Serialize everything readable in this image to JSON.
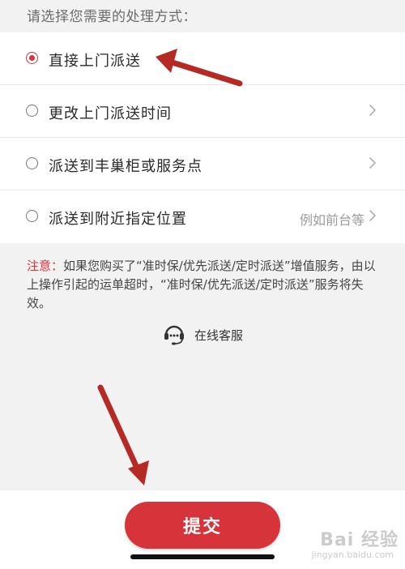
{
  "prompt": "请选择您需要的处理方式：",
  "options": [
    {
      "label": "直接上门派送",
      "selected": true,
      "hint": ""
    },
    {
      "label": "更改上门派送时间",
      "selected": false,
      "hint": ""
    },
    {
      "label": "派送到丰巢柜或服务点",
      "selected": false,
      "hint": ""
    },
    {
      "label": "派送到附近指定位置",
      "selected": false,
      "hint": "例如前台等"
    }
  ],
  "notice": {
    "label": "注意：",
    "text": "如果您购买了“准时保/优先派送/定时派送”增值服务，由以上操作引起的运单超时，“准时保/优先派送/定时派送”服务将失效。"
  },
  "service": {
    "label": "在线客服",
    "icon": "customer-service-icon"
  },
  "submit": {
    "label": "提交"
  },
  "watermark": {
    "main": "Bai 经验",
    "sub": "jingyan.baidu.com"
  },
  "colors": {
    "accent": "#d7333b",
    "background": "#f2f2f2",
    "arrow": "#b52a25"
  }
}
